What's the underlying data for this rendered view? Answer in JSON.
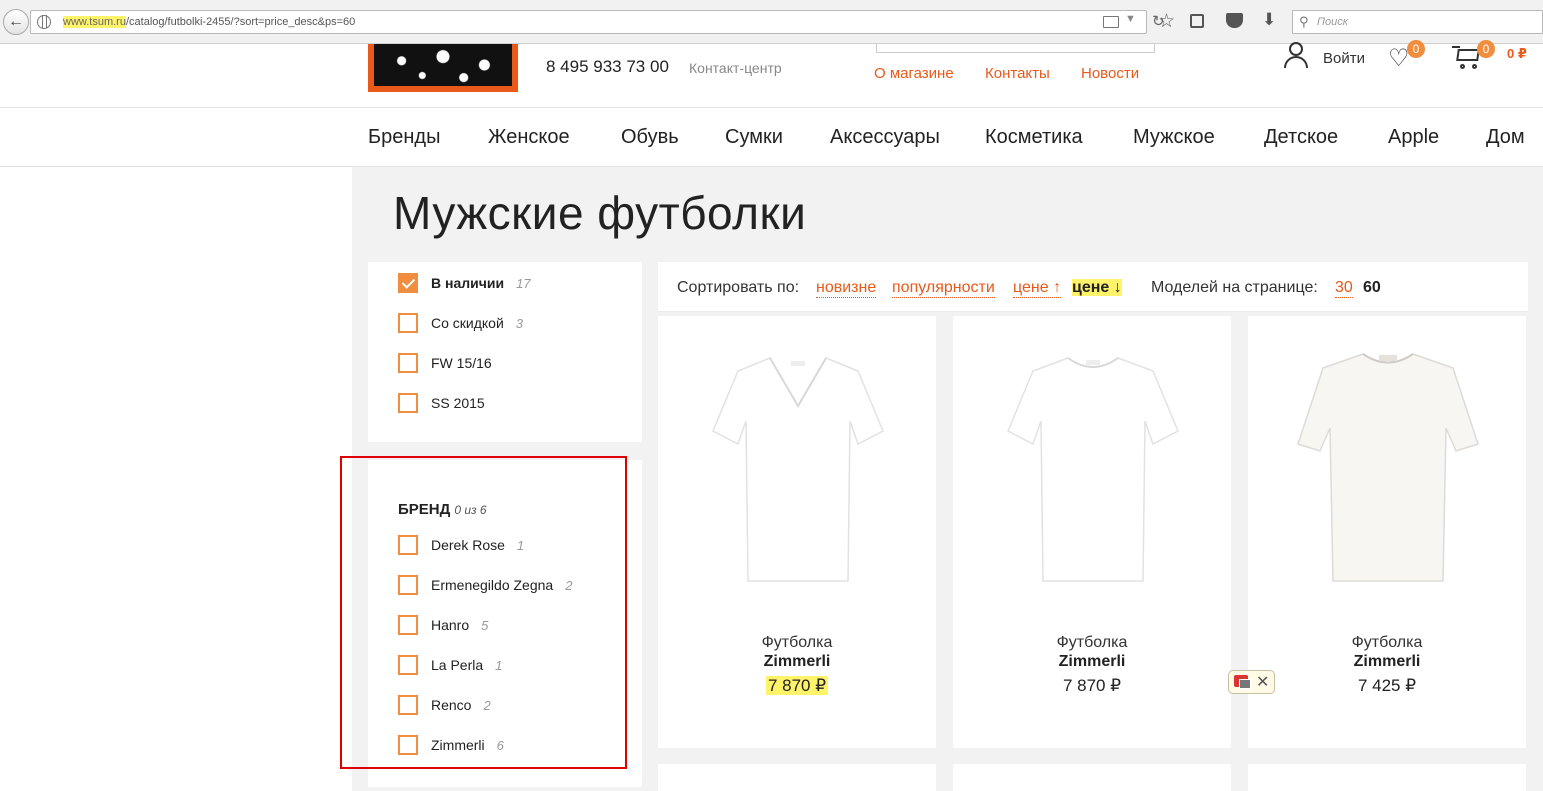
{
  "browser": {
    "url_host": "www.tsum.ru",
    "url_path": "/catalog/futbolki-2455/?sort=price_desc&ps=60",
    "search_placeholder": "Поиск",
    "icons": [
      "back-arrow-icon",
      "globe-icon",
      "reader-icon",
      "reload-icon",
      "star-icon",
      "library-icon",
      "pocket-icon",
      "download-icon",
      "search-icon"
    ]
  },
  "header": {
    "phone": "8 495 933 73 00",
    "phone_label": "Контакт-центр",
    "links": [
      "О магазине",
      "Контакты",
      "Новости"
    ],
    "login_label": "Войти",
    "wishlist_count": "0",
    "cart_count": "0",
    "cart_total": "0 ₽"
  },
  "nav": {
    "items": [
      "Бренды",
      "Женское",
      "Обувь",
      "Сумки",
      "Аксессуары",
      "Косметика",
      "Мужское",
      "Детское",
      "Apple",
      "Дом"
    ]
  },
  "page": {
    "title": "Мужские футболки"
  },
  "filters": {
    "availability": [
      {
        "label": "В наличии",
        "count": "17",
        "checked": true
      },
      {
        "label": "Со скидкой",
        "count": "3",
        "checked": false
      },
      {
        "label": "FW 15/16",
        "count": "",
        "checked": false
      },
      {
        "label": "SS 2015",
        "count": "",
        "checked": false
      }
    ],
    "brand_title": "БРЕНД",
    "brand_selected": "0 из 6",
    "brands": [
      {
        "label": "Derek Rose",
        "count": "1"
      },
      {
        "label": "Ermenegildo Zegna",
        "count": "2"
      },
      {
        "label": "Hanro",
        "count": "5"
      },
      {
        "label": "La Perla",
        "count": "1"
      },
      {
        "label": "Renco",
        "count": "2"
      },
      {
        "label": "Zimmerli",
        "count": "6"
      }
    ]
  },
  "sort": {
    "label": "Сортировать по:",
    "options": [
      "новизне",
      "популярности",
      "цене ↑"
    ],
    "active": "цене ↓",
    "per_page_label": "Моделей на странице:",
    "per_page_option": "30",
    "per_page_active": "60"
  },
  "products": [
    {
      "type": "Футболка",
      "brand": "Zimmerli",
      "price": "7 870 ₽"
    },
    {
      "type": "Футболка",
      "brand": "Zimmerli",
      "price": "7 870 ₽"
    },
    {
      "type": "Футболка",
      "brand": "Zimmerli",
      "price": "7 425 ₽"
    }
  ],
  "colors": {
    "accent": "#e8591a",
    "checkbox": "#f08d3e",
    "highlight": "#fff36a",
    "annotation_box": "#e00000"
  }
}
